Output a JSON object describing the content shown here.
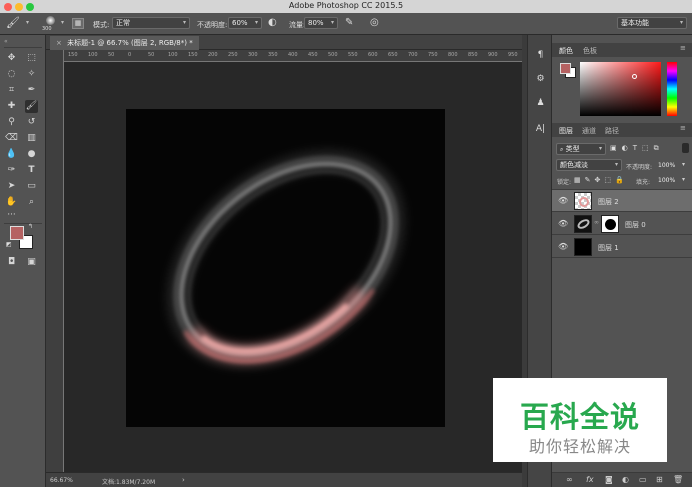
{
  "app": {
    "title": "Adobe Photoshop CC 2015.5"
  },
  "options_bar": {
    "brush_size": "300",
    "mode_label": "模式:",
    "mode_value": "正常",
    "opacity_label": "不透明度:",
    "opacity_value": "60%",
    "flow_label": "流量:",
    "flow_value": "80%",
    "workspace_value": "基本功能"
  },
  "document": {
    "tab_label": "未标题-1 @ 66.7% (图层 2, RGB/8*) *",
    "ruler_ticks": [
      "150",
      "100",
      "50",
      "0",
      "50",
      "100",
      "150",
      "200",
      "250",
      "300",
      "350",
      "400",
      "450",
      "500",
      "550",
      "600",
      "650",
      "700",
      "750",
      "800",
      "850",
      "900",
      "950"
    ]
  },
  "status": {
    "zoom": "66.67%",
    "doc_info": "文档:1.83M/7.20M"
  },
  "colors": {
    "foreground": "#b56262",
    "background": "#ffffff"
  },
  "color_panel": {
    "tab_color": "颜色",
    "tab_swatches": "色板"
  },
  "layers_panel": {
    "tab_layers": "图层",
    "tab_channels": "通道",
    "tab_paths": "路径",
    "filter_kind": "类型",
    "blend_mode": "颜色减淡",
    "opacity_label": "不透明度:",
    "opacity_value": "100%",
    "lock_label": "锁定:",
    "fill_label": "填充:",
    "fill_value": "100%",
    "layers": [
      {
        "name": "图层 2"
      },
      {
        "name": "图层 0"
      },
      {
        "name": "图层 1"
      }
    ]
  },
  "watermark": {
    "line1": "百科全说",
    "line2": "助你轻松解决"
  }
}
